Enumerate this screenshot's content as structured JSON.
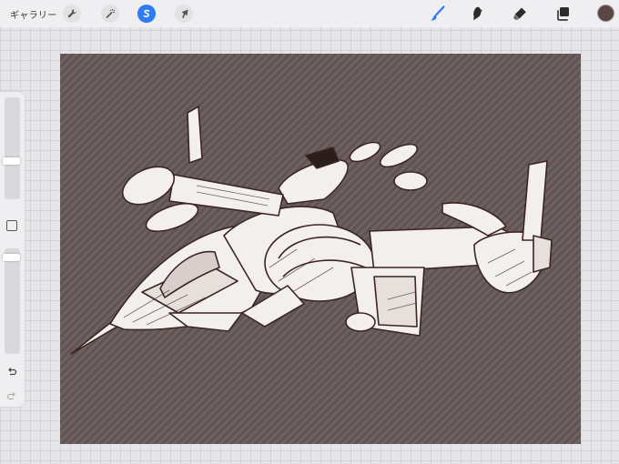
{
  "toolbar": {
    "gallery_label": "ギャラリー",
    "left_tools": [
      {
        "icon": "wrench-icon",
        "name": "actions"
      },
      {
        "icon": "magic-wand-icon",
        "name": "adjustments"
      },
      {
        "icon": "selection-s-icon",
        "name": "selection",
        "active": true
      },
      {
        "icon": "arrow-cursor-icon",
        "name": "transform"
      }
    ],
    "right_tools": [
      {
        "icon": "brush-icon",
        "name": "paint",
        "active": true
      },
      {
        "icon": "smudge-icon",
        "name": "smudge"
      },
      {
        "icon": "eraser-icon",
        "name": "erase"
      },
      {
        "icon": "layers-icon",
        "name": "layers"
      }
    ],
    "current_color": "#5b4644"
  },
  "sidebar": {
    "brush_size_level": 0.65,
    "opacity_level": 0.02
  },
  "colors": {
    "accent": "#2f7bf2",
    "canvas_bg": "#6e6160",
    "sketch_line": "#3b2523",
    "sketch_fill": "#f3efed"
  }
}
